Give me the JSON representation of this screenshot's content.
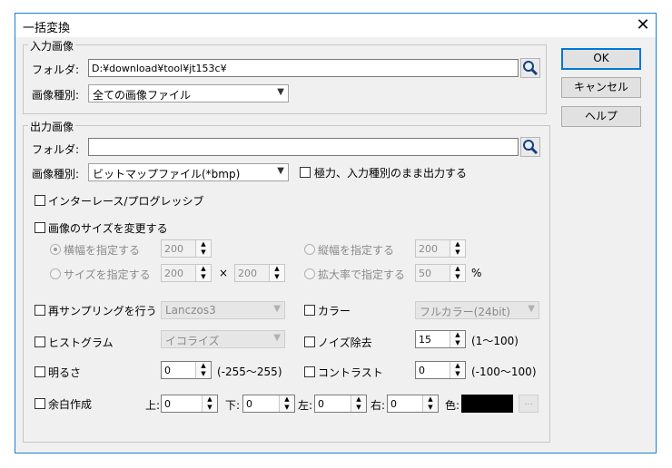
{
  "window": {
    "title": "一括変換",
    "close": "✕"
  },
  "buttons": {
    "ok": "OK",
    "cancel": "キャンセル",
    "help": "ヘルプ"
  },
  "input_group": {
    "legend": "入力画像",
    "folder_label": "フォルダ:",
    "folder_value": "D:¥download¥tool¥jt153c¥",
    "type_label": "画像種別:",
    "type_value": "全ての画像ファイル"
  },
  "output_group": {
    "legend": "出力画像",
    "folder_label": "フォルダ:",
    "folder_value": "",
    "type_label": "画像種別:",
    "type_value": "ビットマップファイル(*bmp)",
    "keep_type_label": "極力、入力種別のまま出力する",
    "interlace_label": "インターレース/プログレッシブ",
    "resize_label": "画像のサイズを変更する",
    "width_radio": "横幅を指定する",
    "width_value": "200",
    "height_radio": "縦幅を指定する",
    "height_value": "200",
    "size_radio": "サイズを指定する",
    "size_w": "200",
    "times": "×",
    "size_h": "200",
    "scale_radio": "拡大率で指定する",
    "scale_value": "50",
    "percent": "%",
    "resample_label": "再サンプリングを行う",
    "resample_value": "Lanczos3",
    "color_label": "カラー",
    "color_value": "フルカラー(24bit)",
    "histogram_label": "ヒストグラム",
    "histogram_value": "イコライズ",
    "noise_label": "ノイズ除去",
    "noise_value": "15",
    "noise_range": "(1〜100)",
    "brightness_label": "明るさ",
    "brightness_value": "0",
    "brightness_range": "(-255〜255)",
    "contrast_label": "コントラスト",
    "contrast_value": "0",
    "contrast_range": "(-100〜100)",
    "margin_label": "余白作成",
    "top_label": "上:",
    "top_value": "0",
    "bottom_label": "下:",
    "bottom_value": "0",
    "left_label": "左:",
    "left_value": "0",
    "right_label": "右:",
    "right_value": "0",
    "color2_label": "色:",
    "color_swatch": "#000000",
    "browse_label": "..."
  }
}
